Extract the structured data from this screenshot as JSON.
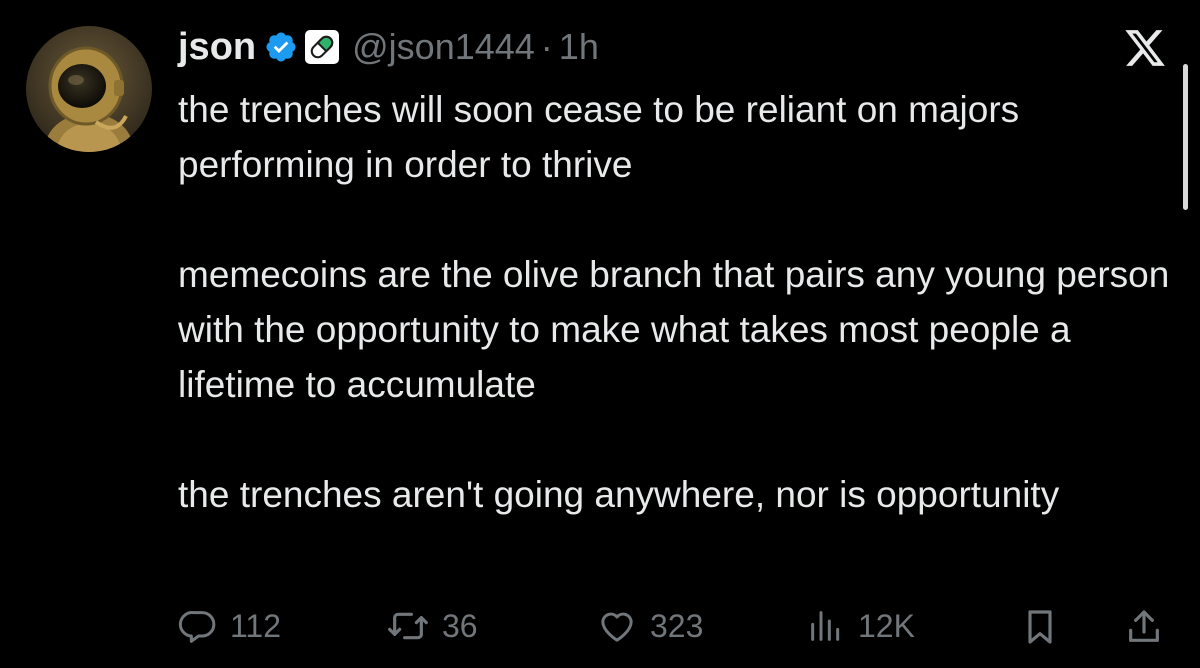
{
  "author": {
    "name": "json",
    "handle": "@json1444",
    "separator": "·",
    "time": "1h",
    "avatar_icon": "astronaut-avatar",
    "verified_icon": "verified-badge-icon",
    "affiliate_icon": "pill-badge-icon"
  },
  "tweet": {
    "paragraphs": [
      "the trenches will soon cease to be reliant on majors performing in order to thrive",
      "memecoins are the olive branch that pairs any young person with the opportunity to make what takes most people a lifetime to accumulate",
      "the trenches aren't going anywhere, nor is opportunity"
    ]
  },
  "actions": {
    "replies": "112",
    "reposts": "36",
    "likes": "323",
    "views": "12K"
  },
  "colors": {
    "background": "#000000",
    "text": "#e7e9ea",
    "muted": "#71767b",
    "verified": "#1d9bf0",
    "affiliate": "#2fb36a"
  },
  "brand": {
    "logo_icon": "x-logo-icon"
  }
}
